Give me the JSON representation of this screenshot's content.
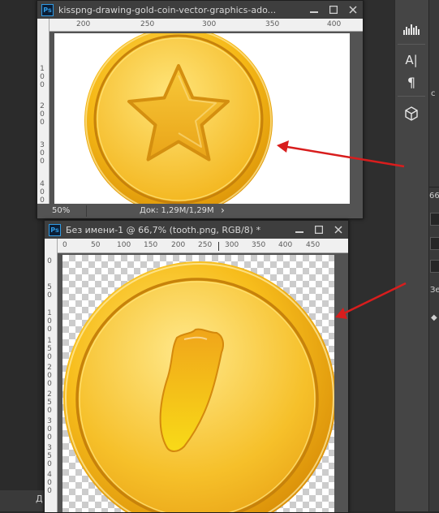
{
  "workspace": {
    "bottom_letter": "Д"
  },
  "doc1": {
    "icon_text": "Ps",
    "title": "kisspng-drawing-gold-coin-vector-graphics-ado...",
    "ruler_top_ticks": [
      "200",
      "250",
      "300",
      "350",
      "400"
    ],
    "ruler_left_ticks": [
      "100",
      "200",
      "300",
      "400"
    ],
    "zoom": "50%",
    "doc_info": "Док: 1,29М/1,29М",
    "scroll_arrow": "›"
  },
  "doc2": {
    "icon_text": "Ps",
    "title": "Без имени-1 @ 66,7% (tooth.png, RGB/8) *",
    "ruler_top_ticks": [
      "0",
      "50",
      "100",
      "150",
      "200",
      "250",
      "300",
      "350",
      "400",
      "450"
    ],
    "ruler_left_ticks": [
      "0",
      "50",
      "100",
      "150",
      "200",
      "250",
      "300",
      "350",
      "400"
    ]
  },
  "right_panel": {
    "tools": [
      {
        "name": "histogram-icon",
        "glyph": "▟▙▟"
      },
      {
        "name": "character-icon",
        "glyph": "A|"
      },
      {
        "name": "paragraph-icon",
        "glyph": "¶"
      },
      {
        "name": "3d-cube-icon",
        "glyph": "⬢"
      }
    ],
    "fragments": [
      "с",
      "66",
      "Зе",
      "◆"
    ]
  },
  "colors": {
    "annotation_arrow": "#d81d1d",
    "coin_gold": "#f5b816",
    "coin_dark": "#c7820b"
  }
}
